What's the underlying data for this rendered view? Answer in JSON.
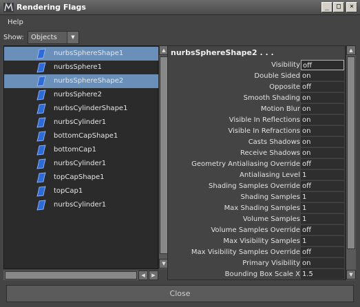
{
  "window": {
    "title": "Rendering Flags"
  },
  "menu": {
    "help": "Help"
  },
  "show": {
    "label": "Show:",
    "value": "Objects"
  },
  "outliner": {
    "items": [
      {
        "label": "nurbsSphereShape1",
        "selected": true
      },
      {
        "label": "nurbsSphere1",
        "selected": false
      },
      {
        "label": "nurbsSphereShape2",
        "selected": true
      },
      {
        "label": "nurbsSphere2",
        "selected": false
      },
      {
        "label": "nurbsCylinderShape1",
        "selected": false
      },
      {
        "label": "nurbsCylinder1",
        "selected": false
      },
      {
        "label": "bottomCapShape1",
        "selected": false
      },
      {
        "label": "bottomCap1",
        "selected": false
      },
      {
        "label": "nurbsCylinder1",
        "selected": false
      },
      {
        "label": "topCapShape1",
        "selected": false
      },
      {
        "label": "topCap1",
        "selected": false
      },
      {
        "label": "nurbsCylinder1",
        "selected": false
      }
    ]
  },
  "attributes": {
    "title": "nurbsSphereShape2 . . .",
    "rows": [
      {
        "label": "Visibility",
        "value": "off"
      },
      {
        "label": "Double Sided",
        "value": "on"
      },
      {
        "label": "Opposite",
        "value": "off"
      },
      {
        "label": "Smooth Shading",
        "value": "on"
      },
      {
        "label": "Motion Blur",
        "value": "on"
      },
      {
        "label": "Visible In Reflections",
        "value": "on"
      },
      {
        "label": "Visible In Refractions",
        "value": "on"
      },
      {
        "label": "Casts Shadows",
        "value": "on"
      },
      {
        "label": "Receive Shadows",
        "value": "on"
      },
      {
        "label": "Geometry Antialiasing Override",
        "value": "off"
      },
      {
        "label": "Antialiasing Level",
        "value": "1"
      },
      {
        "label": "Shading Samples Override",
        "value": "off"
      },
      {
        "label": "Shading Samples",
        "value": "1"
      },
      {
        "label": "Max Shading Samples",
        "value": "1"
      },
      {
        "label": "Volume Samples",
        "value": "1"
      },
      {
        "label": "Volume Samples Override",
        "value": "off"
      },
      {
        "label": "Max Visibility Samples",
        "value": "1"
      },
      {
        "label": "Max Visibility Samples Override",
        "value": "off"
      },
      {
        "label": "Primary Visibility",
        "value": "on"
      },
      {
        "label": "Bounding Box Scale X",
        "value": "1.5"
      }
    ]
  },
  "footer": {
    "close_label": "Close"
  },
  "colors": {
    "selection": "#6a8fb8",
    "background": "#444444",
    "field": "#2e2e2e",
    "nurbs_icon": "#2f6bd6"
  }
}
